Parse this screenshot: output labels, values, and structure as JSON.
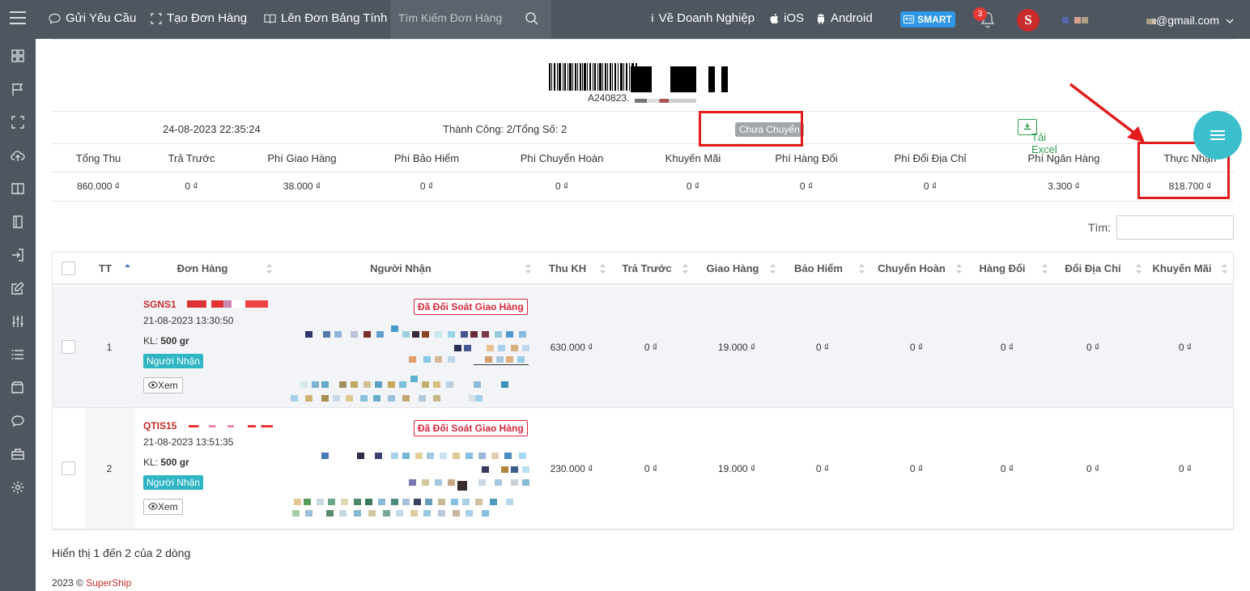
{
  "topbar": {
    "nav": [
      {
        "label": "Gửi Yêu Cầu",
        "icon": "chat-icon"
      },
      {
        "label": "Tạo Đơn Hàng",
        "icon": "expand-icon"
      },
      {
        "label": "Lên Đơn Bảng Tính",
        "icon": "book-icon"
      }
    ],
    "search_placeholder": "Tìm Kiếm Đơn Hàng",
    "links": [
      {
        "label": "Về Doanh Nghiệp",
        "icon": "info-icon"
      },
      {
        "label": "iOS",
        "icon": "apple-icon"
      },
      {
        "label": "Android",
        "icon": "android-icon"
      }
    ],
    "smart_label": "SMART",
    "notification_count": "3",
    "logo_letter": "S",
    "user_email": "@gmail.com"
  },
  "sidebar": {
    "icons": [
      "dashboard-icon",
      "flag-icon",
      "expand-icon",
      "cloud-upload-icon",
      "book-icon",
      "notebook-icon",
      "sign-in-icon",
      "edit-icon",
      "sliders-icon",
      "list-icon",
      "wallet-icon",
      "chat-icon",
      "briefcase-icon",
      "settings-icon"
    ]
  },
  "header": {
    "order_code": "A240823.",
    "datetime": "24-08-2023 22:35:24",
    "success_text": "Thành Công: 2/Tổng Số: 2",
    "status_badge": "Chưa Chuyển",
    "excel_button": "Tải Excel"
  },
  "summary": {
    "columns": [
      {
        "label": "Tổng Thu",
        "value": "860.000 ₫"
      },
      {
        "label": "Trả Trước",
        "value": "0 ₫"
      },
      {
        "label": "Phí Giao Hàng",
        "value": "38.000 ₫"
      },
      {
        "label": "Phí Bảo Hiểm",
        "value": "0 ₫"
      },
      {
        "label": "Phí Chuyển Hoàn",
        "value": "0 ₫"
      },
      {
        "label": "Khuyến Mãi",
        "value": "0 ₫"
      },
      {
        "label": "Phí Hàng Đổi",
        "value": "0 ₫"
      },
      {
        "label": "Phí Đổi Địa Chỉ",
        "value": "0 ₫"
      },
      {
        "label": "Phí Ngân Hàng",
        "value": "3.300 ₫"
      },
      {
        "label": "Thực Nhận",
        "value": "818.700 ₫"
      }
    ]
  },
  "search": {
    "label": "Tìm:"
  },
  "table": {
    "headers": [
      "TT",
      "Đơn Hàng",
      "Người Nhận",
      "Thu KH",
      "Trả Trước",
      "Giao Hàng",
      "Bảo Hiểm",
      "Chuyển Hoàn",
      "Hàng Đổi",
      "Đổi Địa Chỉ",
      "Khuyến Mãi"
    ],
    "rows": [
      {
        "index": "1",
        "order_id": "SGNS1",
        "created": "21-08-2023 13:30:50",
        "weight_label": "KL:",
        "weight": "500 gr",
        "payer": "Người Nhận",
        "view": "Xem",
        "status": "Đã Đối Soát Giao Hàng",
        "values": [
          "630.000 ₫",
          "0 ₫",
          "19.000 ₫",
          "0 ₫",
          "0 ₫",
          "0 ₫",
          "0 ₫",
          "0 ₫"
        ]
      },
      {
        "index": "2",
        "order_id": "QTIS15",
        "created": "21-08-2023 13:51:35",
        "weight_label": "KL:",
        "weight": "500 gr",
        "payer": "Người Nhận",
        "view": "Xem",
        "status": "Đã Đối Soát Giao Hàng",
        "values": [
          "230.000 ₫",
          "0 ₫",
          "19.000 ₫",
          "0 ₫",
          "0 ₫",
          "0 ₫",
          "0 ₫",
          "0 ₫"
        ]
      }
    ]
  },
  "footer": {
    "info": "Hiển thị 1 đến 2 của 2 dòng",
    "copyright": "2023 ©",
    "brand": "SuperShip"
  },
  "colors": {
    "navbar": "#4e5660",
    "accent_red": "#c92c2c",
    "annotation_red": "#e21b1b",
    "cyan": "#2fb5c4",
    "excel_green": "#2e9e4a"
  }
}
